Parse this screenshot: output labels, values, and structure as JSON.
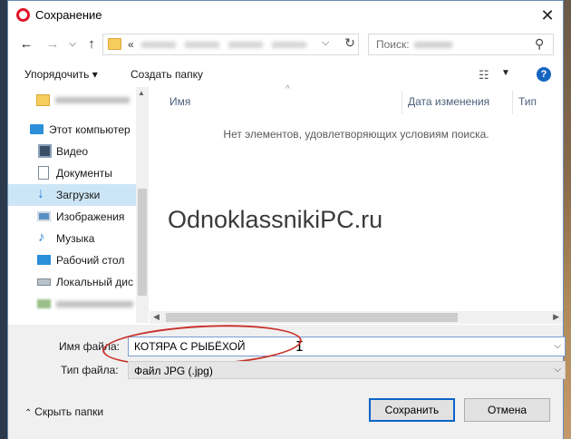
{
  "window": {
    "title": "Сохранение"
  },
  "address": {
    "prefix": "«",
    "chevron": "⌵",
    "refresh": "↻"
  },
  "search": {
    "placeholder": "Поиск:"
  },
  "toolbar": {
    "organize": "Упорядочить ▾",
    "new_folder": "Создать папку",
    "help": "?"
  },
  "sidebar": {
    "items": [
      {
        "label": "",
        "icon": "folder-icon"
      },
      {
        "label": "Этот компьютер",
        "icon": "computer-icon"
      },
      {
        "label": "Видео",
        "icon": "video-icon"
      },
      {
        "label": "Документы",
        "icon": "documents-icon"
      },
      {
        "label": "Загрузки",
        "icon": "downloads-icon",
        "selected": true
      },
      {
        "label": "Изображения",
        "icon": "images-icon"
      },
      {
        "label": "Музыка",
        "icon": "music-icon"
      },
      {
        "label": "Рабочий стол",
        "icon": "desktop-icon"
      },
      {
        "label": "Локальный дис",
        "icon": "drive-icon"
      },
      {
        "label": "",
        "icon": "network-icon"
      }
    ]
  },
  "columns": {
    "name": "Имя",
    "date": "Дата изменения",
    "type": "Тип"
  },
  "content": {
    "empty_message": "Нет элементов, удовлетворяющих условиям поиска."
  },
  "watermark": "OdnoklassnikiPC.ru",
  "form": {
    "filename_label": "Имя файла:",
    "filename_value": "КОТЯРА С РЫБЁХОЙ",
    "filetype_label": "Тип файла:",
    "filetype_value": "Файл JPG (.jpg)"
  },
  "footer": {
    "hide_folders": "Скрыть папки",
    "save": "Сохранить",
    "cancel": "Отмена"
  },
  "colors": {
    "accent": "#0a64c7",
    "selection": "#cde6f7",
    "highlight_ellipse": "#c9312b",
    "opera": "#e0162b"
  }
}
